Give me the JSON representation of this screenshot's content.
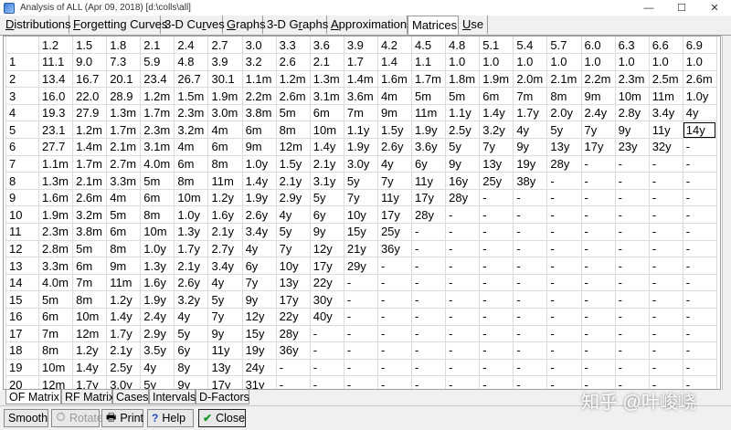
{
  "window": {
    "title": "Analysis of ALL (Apr 09, 2018) [d:\\colls\\all]",
    "minimize_symbol": "—",
    "maximize_symbol": "☐",
    "close_symbol": "✕"
  },
  "tabs": [
    {
      "label": "Distributions",
      "active": false
    },
    {
      "label": "Forgetting Curves",
      "active": false
    },
    {
      "label": "3-D Curves",
      "active": false
    },
    {
      "label": "Graphs",
      "active": false
    },
    {
      "label": "3-D Graphs",
      "active": false
    },
    {
      "label": "Approximations",
      "active": false
    },
    {
      "label": "Matrices",
      "active": true
    },
    {
      "label": "Use",
      "active": false
    }
  ],
  "matrix": {
    "column_headers": [
      "1.2",
      "1.5",
      "1.8",
      "2.1",
      "2.4",
      "2.7",
      "3.0",
      "3.3",
      "3.6",
      "3.9",
      "4.2",
      "4.5",
      "4.8",
      "5.1",
      "5.4",
      "5.7",
      "6.0",
      "6.3",
      "6.6",
      "6.9"
    ],
    "rows": [
      {
        "label": "1",
        "cells": [
          "11.1",
          "9.0",
          "7.3",
          "5.9",
          "4.8",
          "3.9",
          "3.2",
          "2.6",
          "2.1",
          "1.7",
          "1.4",
          "1.1",
          "1.0",
          "1.0",
          "1.0",
          "1.0",
          "1.0",
          "1.0",
          "1.0",
          "1.0"
        ]
      },
      {
        "label": "2",
        "cells": [
          "13.4",
          "16.7",
          "20.1",
          "23.4",
          "26.7",
          "30.1",
          "1.1m",
          "1.2m",
          "1.3m",
          "1.4m",
          "1.6m",
          "1.7m",
          "1.8m",
          "1.9m",
          "2.0m",
          "2.1m",
          "2.2m",
          "2.3m",
          "2.5m",
          "2.6m"
        ]
      },
      {
        "label": "3",
        "cells": [
          "16.0",
          "22.0",
          "28.9",
          "1.2m",
          "1.5m",
          "1.9m",
          "2.2m",
          "2.6m",
          "3.1m",
          "3.6m",
          "4m",
          "5m",
          "5m",
          "6m",
          "7m",
          "8m",
          "9m",
          "10m",
          "11m",
          "1.0y"
        ]
      },
      {
        "label": "4",
        "cells": [
          "19.3",
          "27.9",
          "1.3m",
          "1.7m",
          "2.3m",
          "3.0m",
          "3.8m",
          "5m",
          "6m",
          "7m",
          "9m",
          "11m",
          "1.1y",
          "1.4y",
          "1.7y",
          "2.0y",
          "2.4y",
          "2.8y",
          "3.4y",
          "4y"
        ]
      },
      {
        "label": "5",
        "cells": [
          "23.1",
          "1.2m",
          "1.7m",
          "2.3m",
          "3.2m",
          "4m",
          "6m",
          "8m",
          "10m",
          "1.1y",
          "1.5y",
          "1.9y",
          "2.5y",
          "3.2y",
          "4y",
          "5y",
          "7y",
          "9y",
          "11y",
          "14y"
        ]
      },
      {
        "label": "6",
        "cells": [
          "27.7",
          "1.4m",
          "2.1m",
          "3.1m",
          "4m",
          "6m",
          "9m",
          "12m",
          "1.4y",
          "1.9y",
          "2.6y",
          "3.6y",
          "5y",
          "7y",
          "9y",
          "13y",
          "17y",
          "23y",
          "32y",
          "-"
        ]
      },
      {
        "label": "7",
        "cells": [
          "1.1m",
          "1.7m",
          "2.7m",
          "4.0m",
          "6m",
          "8m",
          "1.0y",
          "1.5y",
          "2.1y",
          "3.0y",
          "4y",
          "6y",
          "9y",
          "13y",
          "19y",
          "28y",
          "-",
          "-",
          "-",
          "-"
        ]
      },
      {
        "label": "8",
        "cells": [
          "1.3m",
          "2.1m",
          "3.3m",
          "5m",
          "8m",
          "11m",
          "1.4y",
          "2.1y",
          "3.1y",
          "5y",
          "7y",
          "11y",
          "16y",
          "25y",
          "38y",
          "-",
          "-",
          "-",
          "-",
          "-"
        ]
      },
      {
        "label": "9",
        "cells": [
          "1.6m",
          "2.6m",
          "4m",
          "6m",
          "10m",
          "1.2y",
          "1.9y",
          "2.9y",
          "5y",
          "7y",
          "11y",
          "17y",
          "28y",
          "-",
          "-",
          "-",
          "-",
          "-",
          "-",
          "-"
        ]
      },
      {
        "label": "10",
        "cells": [
          "1.9m",
          "3.2m",
          "5m",
          "8m",
          "1.0y",
          "1.6y",
          "2.6y",
          "4y",
          "6y",
          "10y",
          "17y",
          "28y",
          "-",
          "-",
          "-",
          "-",
          "-",
          "-",
          "-",
          "-"
        ]
      },
      {
        "label": "11",
        "cells": [
          "2.3m",
          "3.8m",
          "6m",
          "10m",
          "1.3y",
          "2.1y",
          "3.4y",
          "5y",
          "9y",
          "15y",
          "25y",
          "-",
          "-",
          "-",
          "-",
          "-",
          "-",
          "-",
          "-",
          "-"
        ]
      },
      {
        "label": "12",
        "cells": [
          "2.8m",
          "5m",
          "8m",
          "1.0y",
          "1.7y",
          "2.7y",
          "4y",
          "7y",
          "12y",
          "21y",
          "36y",
          "-",
          "-",
          "-",
          "-",
          "-",
          "-",
          "-",
          "-",
          "-"
        ]
      },
      {
        "label": "13",
        "cells": [
          "3.3m",
          "6m",
          "9m",
          "1.3y",
          "2.1y",
          "3.4y",
          "6y",
          "10y",
          "17y",
          "29y",
          "-",
          "-",
          "-",
          "-",
          "-",
          "-",
          "-",
          "-",
          "-",
          "-"
        ]
      },
      {
        "label": "14",
        "cells": [
          "4.0m",
          "7m",
          "11m",
          "1.6y",
          "2.6y",
          "4y",
          "7y",
          "13y",
          "22y",
          "-",
          "-",
          "-",
          "-",
          "-",
          "-",
          "-",
          "-",
          "-",
          "-",
          "-"
        ]
      },
      {
        "label": "15",
        "cells": [
          "5m",
          "8m",
          "1.2y",
          "1.9y",
          "3.2y",
          "5y",
          "9y",
          "17y",
          "30y",
          "-",
          "-",
          "-",
          "-",
          "-",
          "-",
          "-",
          "-",
          "-",
          "-",
          "-"
        ]
      },
      {
        "label": "16",
        "cells": [
          "6m",
          "10m",
          "1.4y",
          "2.4y",
          "4y",
          "7y",
          "12y",
          "22y",
          "40y",
          "-",
          "-",
          "-",
          "-",
          "-",
          "-",
          "-",
          "-",
          "-",
          "-",
          "-"
        ]
      },
      {
        "label": "17",
        "cells": [
          "7m",
          "12m",
          "1.7y",
          "2.9y",
          "5y",
          "9y",
          "15y",
          "28y",
          "-",
          "-",
          "-",
          "-",
          "-",
          "-",
          "-",
          "-",
          "-",
          "-",
          "-",
          "-"
        ]
      },
      {
        "label": "18",
        "cells": [
          "8m",
          "1.2y",
          "2.1y",
          "3.5y",
          "6y",
          "11y",
          "19y",
          "36y",
          "-",
          "-",
          "-",
          "-",
          "-",
          "-",
          "-",
          "-",
          "-",
          "-",
          "-",
          "-"
        ]
      },
      {
        "label": "19",
        "cells": [
          "10m",
          "1.4y",
          "2.5y",
          "4y",
          "8y",
          "13y",
          "24y",
          "-",
          "-",
          "-",
          "-",
          "-",
          "-",
          "-",
          "-",
          "-",
          "-",
          "-",
          "-",
          "-"
        ]
      },
      {
        "label": "20",
        "cells": [
          "12m",
          "1.7y",
          "3.0y",
          "5y",
          "9y",
          "17y",
          "31y",
          "-",
          "-",
          "-",
          "-",
          "-",
          "-",
          "-",
          "-",
          "-",
          "-",
          "-",
          "-",
          "-"
        ]
      }
    ],
    "selected_cell": {
      "row": 5,
      "column": "6.9",
      "value": "14y"
    }
  },
  "bottom_tabs": [
    {
      "label": "OF Matrix",
      "active": true
    },
    {
      "label": "RF Matrix",
      "active": false
    },
    {
      "label": "Cases",
      "active": false
    },
    {
      "label": "Intervals",
      "active": false
    },
    {
      "label": "D-Factors",
      "active": false
    }
  ],
  "buttons": {
    "smooth": {
      "label": "Smooth"
    },
    "rotate": {
      "label": "Rotate",
      "icon": "rotate-icon",
      "disabled": true
    },
    "print": {
      "label": "Print",
      "icon": "printer-icon",
      "glyph": "🖶"
    },
    "help": {
      "label": "Help",
      "icon": "question-icon",
      "glyph": "?"
    },
    "close": {
      "label": "Close",
      "icon": "checkmark-icon",
      "glyph": "✔"
    }
  },
  "watermark": "知乎 @叶峻峣",
  "colors": {
    "close_check": "#1a9a2a",
    "help_icon": "#1f4fbf",
    "grid_line": "#dcdcdc",
    "tab_bar": "#f0f0f0"
  }
}
